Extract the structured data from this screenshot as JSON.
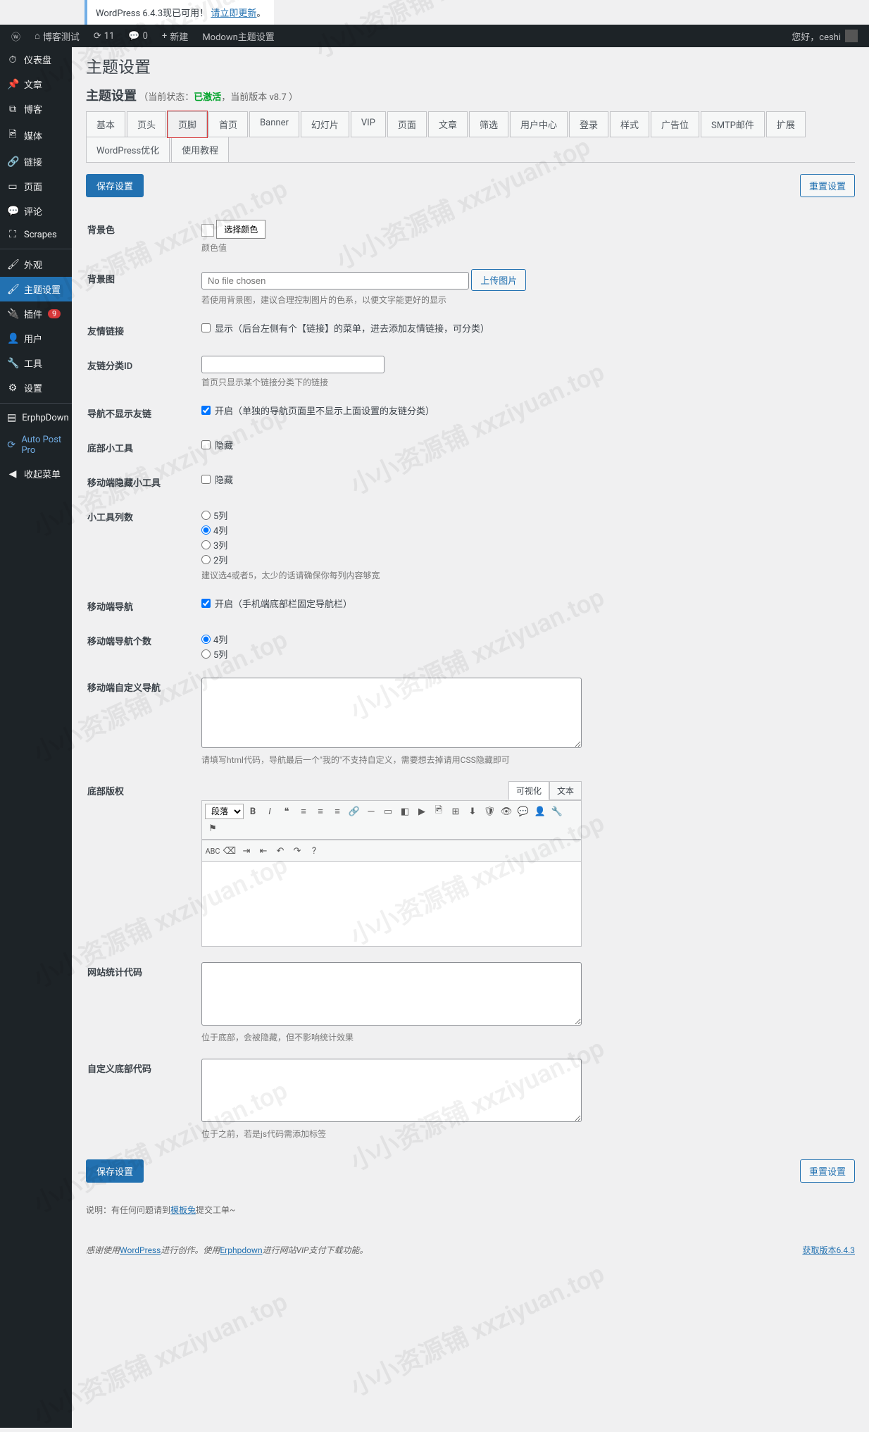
{
  "notice": {
    "text1": "WordPress 6.4.3现已可用！",
    "link": "请立即更新",
    "text2": "。"
  },
  "adminbar": {
    "site": "博客测试",
    "updates": "11",
    "comments": "0",
    "new": "新建",
    "theme_opts": "Modown主题设置",
    "greeting": "您好，ceshi"
  },
  "sidebar": {
    "items": [
      {
        "icon": "⏱",
        "label": "仪表盘"
      },
      {
        "icon": "✎",
        "label": "文章"
      },
      {
        "icon": "⧉",
        "label": "博客"
      },
      {
        "icon": "🖻",
        "label": "媒体"
      },
      {
        "icon": "🔗",
        "label": "链接"
      },
      {
        "icon": "▭",
        "label": "页面"
      },
      {
        "icon": "💬",
        "label": "评论"
      },
      {
        "icon": "⛶",
        "label": "Scrapes"
      }
    ],
    "appearance": [
      {
        "icon": "🖌",
        "label": "外观"
      },
      {
        "icon": "🖌",
        "label": "主题设置",
        "active": true
      },
      {
        "icon": "🔌",
        "label": "插件",
        "badge": "9"
      },
      {
        "icon": "👤",
        "label": "用户"
      },
      {
        "icon": "🔧",
        "label": "工具"
      },
      {
        "icon": "⚙",
        "label": "设置"
      }
    ],
    "extra": [
      {
        "icon": "▤",
        "label": "ErphpDown"
      },
      {
        "icon": "⟳",
        "label": "Auto Post Pro"
      },
      {
        "icon": "◀",
        "label": "收起菜单"
      }
    ]
  },
  "page": {
    "title_top": "主题设置",
    "title": "主题设置",
    "status_prefix": "（当前状态：",
    "status_active": "已激活",
    "status_suffix": "，当前版本 v8.7 ）",
    "tabs": [
      "基本",
      "页头",
      "页脚",
      "首页",
      "Banner",
      "幻灯片",
      "VIP",
      "页面",
      "文章",
      "筛选",
      "用户中心",
      "登录",
      "样式",
      "广告位",
      "SMTP邮件",
      "扩展",
      "WordPress优化",
      "使用教程"
    ],
    "active_tab_index": 2,
    "btn_save": "保存设置",
    "btn_reset": "重置设置"
  },
  "form": {
    "bgcolor": {
      "label": "背景色",
      "btn": "选择颜色",
      "desc": "颜色值"
    },
    "bgimg": {
      "label": "背景图",
      "placeholder": "No file chosen",
      "btn": "上传图片",
      "desc": "若使用背景图，建议合理控制图片的色系，以便文字能更好的显示"
    },
    "flinks": {
      "label": "友情链接",
      "opt": "显示（后台左侧有个【链接】的菜单，进去添加友情链接，可分类）"
    },
    "flinkcat": {
      "label": "友链分类ID",
      "desc": "首页只显示某个链接分类下的链接"
    },
    "navnofl": {
      "label": "导航不显示友链",
      "opt": "开启（单独的导航页面里不显示上面设置的友链分类）"
    },
    "footwidget": {
      "label": "底部小工具",
      "opt": "隐藏"
    },
    "mobwidget": {
      "label": "移动端隐藏小工具",
      "opt": "隐藏"
    },
    "widgetcols": {
      "label": "小工具列数",
      "opts": [
        "5列",
        "4列",
        "3列",
        "2列"
      ],
      "desc": "建议选4或者5，太少的话请确保你每列内容够宽"
    },
    "mobnav": {
      "label": "移动端导航",
      "opt": "开启（手机端底部栏固定导航栏）"
    },
    "mobnavcount": {
      "label": "移动端导航个数",
      "opts": [
        "4列",
        "5列"
      ]
    },
    "mobcustomnav": {
      "label": "移动端自定义导航",
      "desc": "请填写html代码，导航最后一个\"我的\"不支持自定义，需要想去掉请用CSS隐藏即可"
    },
    "copyright": {
      "label": "底部版权"
    },
    "editor": {
      "visual": "可视化",
      "text": "文本",
      "format_sel": "段落"
    },
    "stats": {
      "label": "网站统计代码",
      "desc": "位于底部，会被隐藏，但不影响统计效果"
    },
    "customfoot": {
      "label": "自定义底部代码",
      "desc": "位于之前，若是js代码需添加标签"
    }
  },
  "footer_note": {
    "prefix": "说明：有任何问题请到",
    "link": "模板兔",
    "suffix": "提交工单~"
  },
  "wp_footer": {
    "left_1": "感谢使用",
    "left_link1": "WordPress",
    "left_2": "进行创作。使用",
    "left_link2": "Erphpdown",
    "left_3": "进行网站VIP支付下载功能。",
    "right": "获取版本6.4.3"
  },
  "watermark": "小小资源铺 xxziyuan.top"
}
